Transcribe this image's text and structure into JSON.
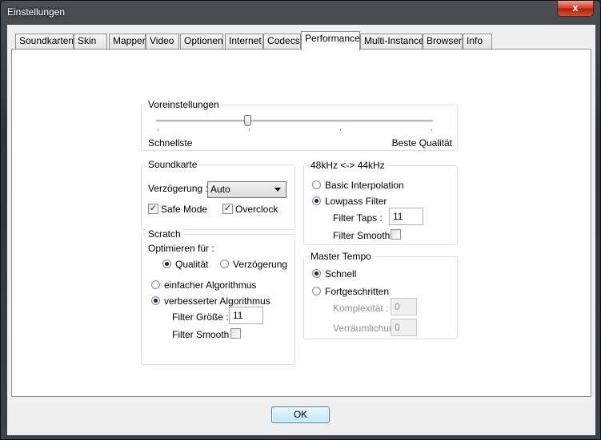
{
  "window": {
    "title": "Einstellungen",
    "close_label": "x"
  },
  "tabs": [
    "Soundkarten",
    "Skin",
    "Mapper",
    "Video",
    "Optionen",
    "Internet",
    "Codecs",
    "Performance",
    "Multi-Instance",
    "Browser",
    "Info"
  ],
  "active_tab": "Performance",
  "presets": {
    "title": "Voreinstellungen",
    "left_label": "Schnellste",
    "right_label": "Beste Qualität",
    "slider_position": 0.33
  },
  "soundcard": {
    "title": "Soundkarte",
    "latency_label": "Verzögerung :",
    "latency_value": "Auto",
    "safe_mode_label": "Safe Mode",
    "safe_mode_checked": true,
    "overclock_label": "Overclock",
    "overclock_checked": true
  },
  "scratch": {
    "title": "Scratch",
    "optimize_label": "Optimieren für :",
    "quality_label": "Qualität",
    "latency_label": "Verzögerung",
    "simple_algo_label": "einfacher Algorithmus",
    "improved_algo_label": "verbesserter Algorithmus",
    "filter_size_label": "Filter Größe :",
    "filter_size_value": "11",
    "filter_smooth_label": "Filter Smooth",
    "filter_smooth_checked": false
  },
  "resample": {
    "title": "48kHz <-> 44kHz",
    "basic_label": "Basic Interpolation",
    "lowpass_label": "Lowpass Filter",
    "filter_taps_label": "Filter Taps :",
    "filter_taps_value": "11",
    "filter_smooth_label": "Filter Smooth",
    "filter_smooth_checked": false
  },
  "master_tempo": {
    "title": "Master Tempo",
    "fast_label": "Schnell",
    "advanced_label": "Fortgeschritten",
    "complexity_label": "Komplexität :",
    "complexity_value": "0",
    "spatial_label": "Verräumlichung",
    "spatial_value": "0"
  },
  "ok_label": "OK"
}
